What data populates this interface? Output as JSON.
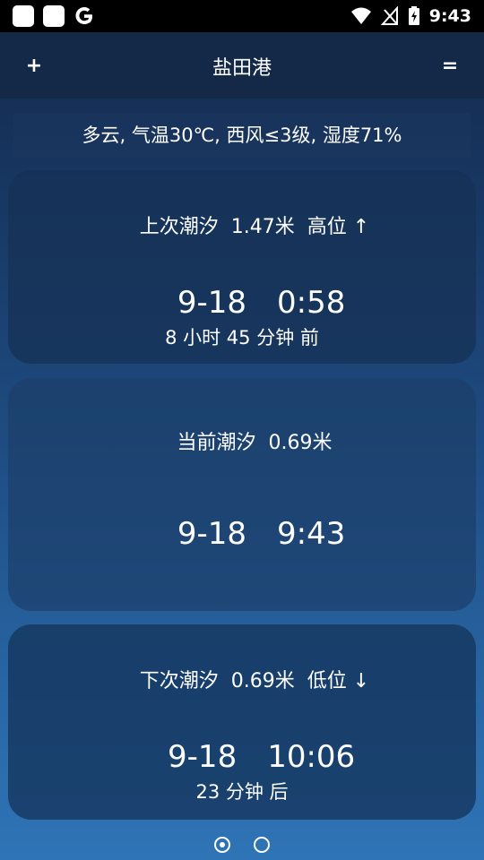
{
  "statusbar": {
    "time": "9:43"
  },
  "header": {
    "add_label": "+",
    "title": "盐田港",
    "menu_label": "="
  },
  "weather": {
    "text": "多云, 气温30℃, 西风≤3级, 湿度71%"
  },
  "cards": [
    {
      "title": "上次潮汐",
      "height": "1.47米",
      "level": "高位",
      "arrow": "↑",
      "date": "9-18",
      "time": "0:58",
      "relative": "8 小时 45 分钟 前"
    },
    {
      "title": "当前潮汐",
      "height": "0.69米",
      "date": "9-18",
      "time": "9:43"
    },
    {
      "title": "下次潮汐",
      "height": "0.69米",
      "level": "低位",
      "arrow": "↓",
      "date": "9-18",
      "time": "10:06",
      "relative": "23 分钟 后"
    }
  ],
  "pager": {
    "current_page": 1,
    "total_pages": 2
  }
}
